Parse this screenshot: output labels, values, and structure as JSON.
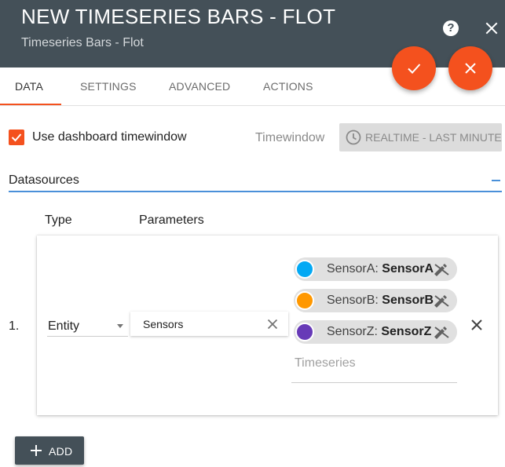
{
  "header": {
    "title": "NEW TIMESERIES BARS - FLOT",
    "subtitle": "Timeseries Bars - Flot",
    "help_icon": "help-circle-icon",
    "help_glyph": "?",
    "close_icon": "close-icon"
  },
  "actions": {
    "apply_icon": "check-icon",
    "cancel_icon": "close-icon",
    "accent_color": "#f4511e"
  },
  "tabs": [
    {
      "label": "DATA",
      "active": true
    },
    {
      "label": "SETTINGS",
      "active": false
    },
    {
      "label": "ADVANCED",
      "active": false
    },
    {
      "label": "ACTIONS",
      "active": false
    }
  ],
  "timewindow": {
    "use_dashboard_label": "Use dashboard timewindow",
    "use_dashboard_checked": true,
    "label": "Timewindow",
    "button_label": "REALTIME - LAST MINUTE",
    "button_icon": "clock-icon"
  },
  "datasources": {
    "title": "Datasources",
    "columns": {
      "type": "Type",
      "parameters": "Parameters"
    },
    "rows": [
      {
        "index": "1.",
        "type": "Entity",
        "entity_alias": "Sensors",
        "timeseries": [
          {
            "label": "SensorA: ",
            "value": "SensorA",
            "color": "#03a9f4"
          },
          {
            "label": "SensorB: ",
            "value": "SensorB",
            "color": "#ff9800"
          },
          {
            "label": "SensorZ: ",
            "value": "SensorZ",
            "color": "#673ab7"
          }
        ],
        "timeseries_placeholder": "Timeseries"
      }
    ],
    "add_label": "ADD",
    "header_color": "#445058"
  }
}
